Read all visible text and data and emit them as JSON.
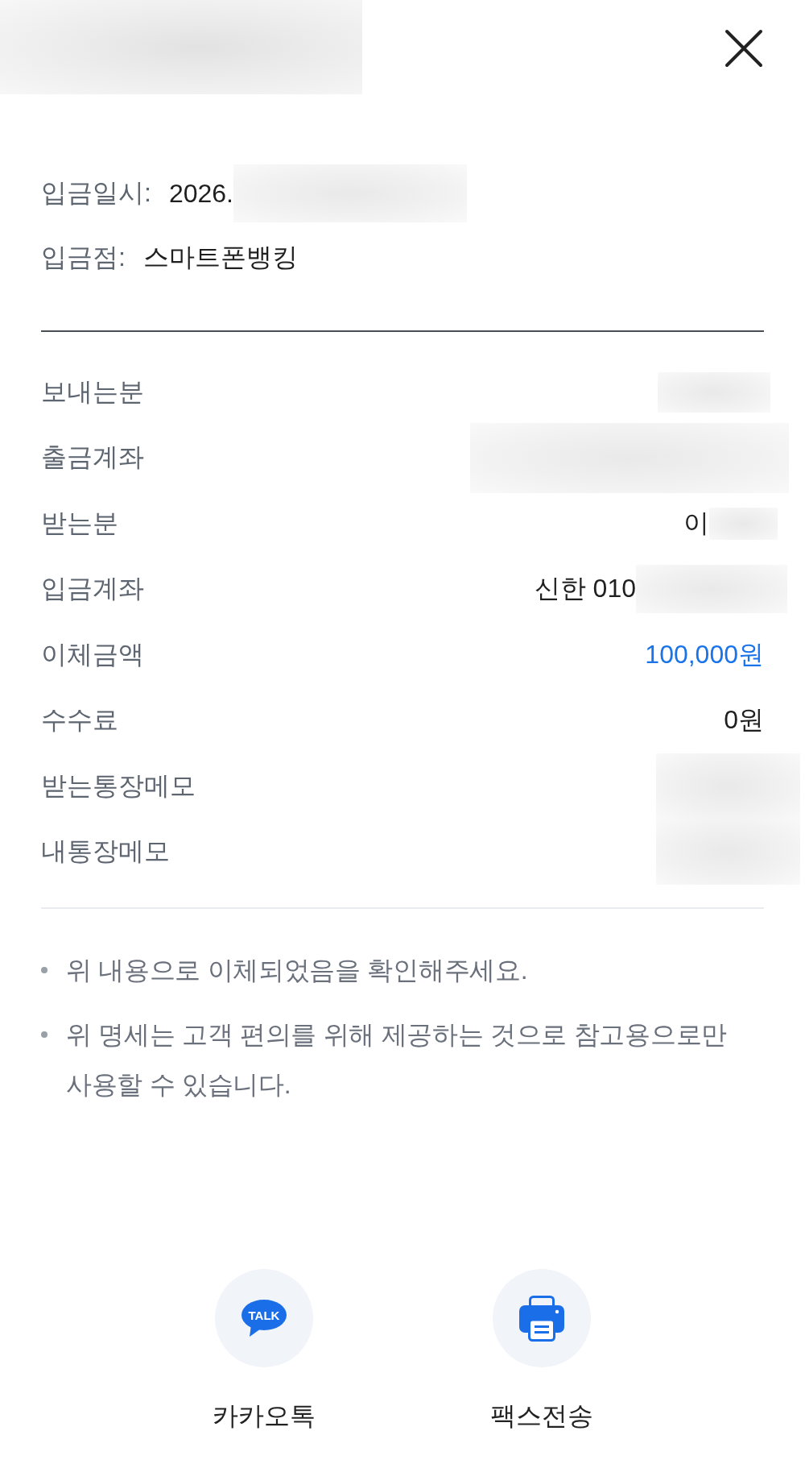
{
  "header": {
    "title_redacted": true
  },
  "deposit_info": [
    {
      "label": "입금일시:",
      "value": "2026.",
      "redacted": true
    },
    {
      "label": "입금점:",
      "value": "스마트폰뱅킹",
      "redacted": false
    }
  ],
  "details": [
    {
      "label": "보내는분",
      "redacted": true
    },
    {
      "label": "출금계좌",
      "redacted": true
    },
    {
      "label": "받는분",
      "value": "이",
      "redacted": true,
      "emphasized": false
    },
    {
      "label": "입금계좌",
      "value": "신한 010",
      "redacted": true,
      "emphasized": false
    },
    {
      "label": "이체금액",
      "value": "100,000원",
      "redacted": false,
      "emphasized": true
    },
    {
      "label": "수수료",
      "value": "0원",
      "redacted": false,
      "emphasized": false
    },
    {
      "label": "받는통장메모",
      "redacted": true
    },
    {
      "label": "내통장메모",
      "redacted": true
    }
  ],
  "notes": [
    "위 내용으로 이체되었음을 확인해주세요.",
    "위 명세는 고객 편의를 위해 제공하는 것으로 참고용으로만 사용할 수 있습니다."
  ],
  "share_buttons": [
    {
      "kind": "kakaotalk",
      "label": "카카오톡",
      "icon_text": "TALK"
    },
    {
      "kind": "fax",
      "label": "팩스전송"
    }
  ]
}
